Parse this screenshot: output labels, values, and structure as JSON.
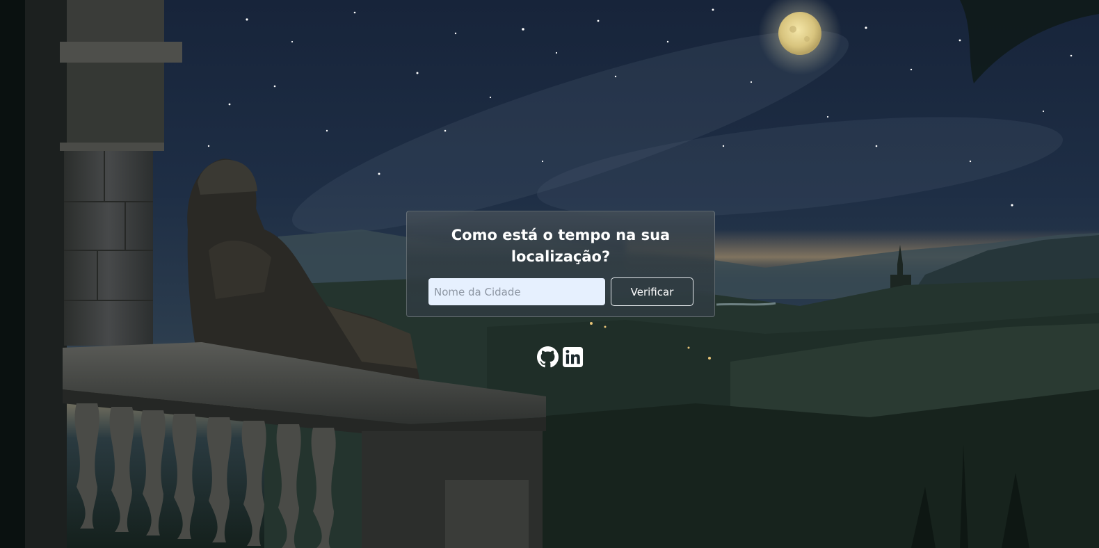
{
  "weather": {
    "title": "Como está o tempo na sua localização?",
    "city_input": {
      "placeholder": "Nome da Cidade",
      "value": ""
    },
    "check_button_label": "Verificar"
  },
  "social": {
    "links": [
      {
        "name": "GitHub",
        "icon": "github-icon"
      },
      {
        "name": "LinkedIn",
        "icon": "linkedin-icon"
      }
    ]
  },
  "colors": {
    "input_background": "#e6f0fe",
    "card_background": "#323c42",
    "text": "#ffffff"
  }
}
